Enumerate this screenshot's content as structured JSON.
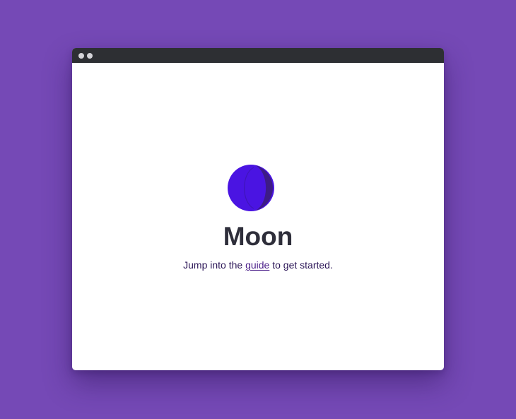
{
  "app": {
    "name": "Moon"
  },
  "hero": {
    "title": "Moon",
    "tagline_before": "Jump into the ",
    "tagline_link": "guide",
    "tagline_after": " to get started."
  },
  "icons": {
    "logo": "moon-logo-icon"
  },
  "colors": {
    "background": "#7549b6",
    "titlebar": "#2d2f33",
    "logo_primary": "#4a14e2",
    "logo_shadow": "#3d1b86",
    "title": "#2e2e3a",
    "text": "#2a1456",
    "link": "#4b1f8a"
  }
}
